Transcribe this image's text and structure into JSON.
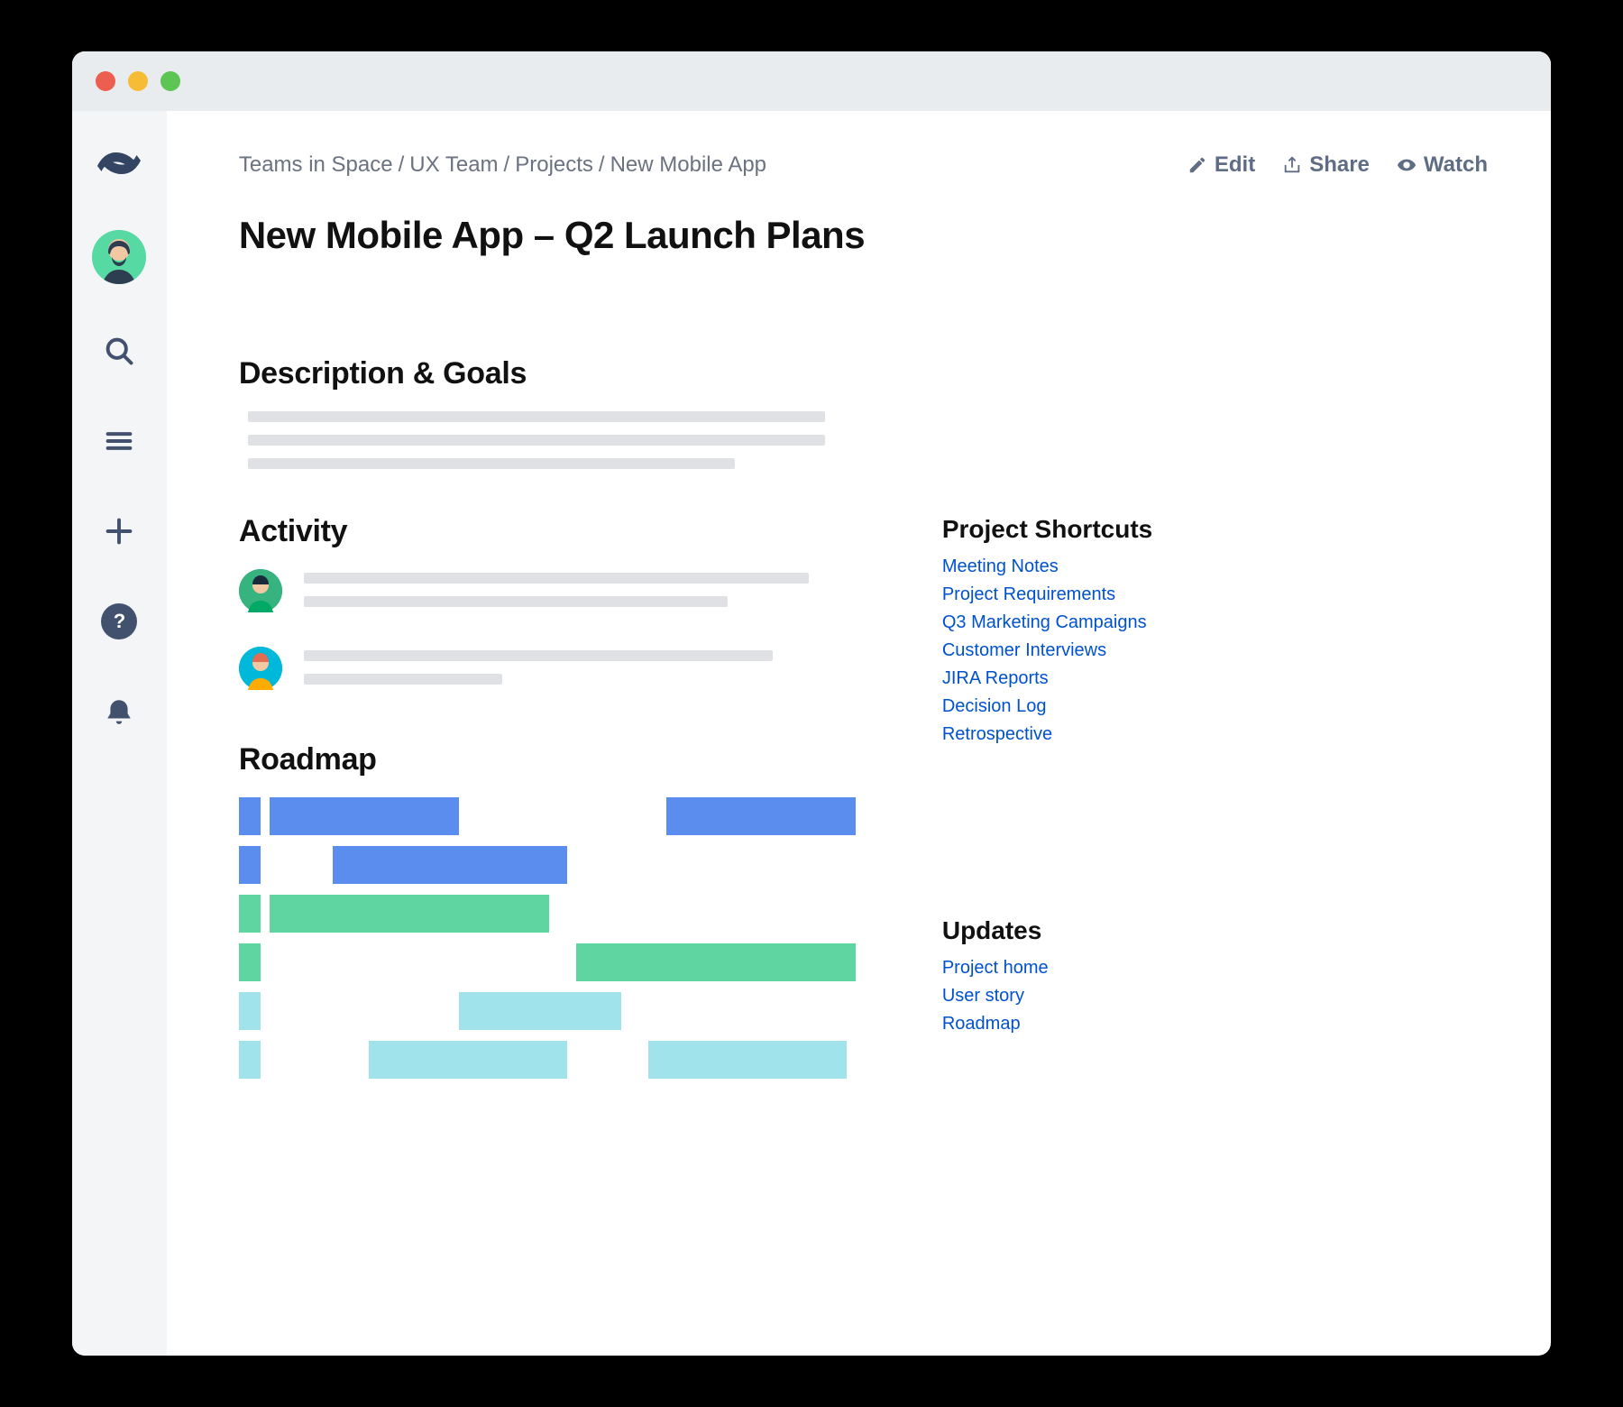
{
  "breadcrumb": [
    "Teams in Space",
    "UX Team",
    "Projects",
    "New Mobile App"
  ],
  "actions": {
    "edit": "Edit",
    "share": "Share",
    "watch": "Watch"
  },
  "page_title": "New Mobile App – Q2 Launch Plans",
  "sections": {
    "description": "Description & Goals",
    "activity": "Activity",
    "roadmap": "Roadmap"
  },
  "sidebar_right": {
    "shortcuts_heading": "Project Shortcuts",
    "shortcuts": [
      "Meeting Notes",
      "Project Requirements",
      "Q3 Marketing Campaigns",
      "Customer Interviews",
      "JIRA Reports",
      "Decision Log",
      "Retrospective"
    ],
    "updates_heading": "Updates",
    "updates": [
      "Project home",
      "User story",
      "Roadmap"
    ]
  },
  "roadmap_colors": {
    "blue": "#5b8def",
    "green": "#5fd6a2",
    "cyan": "#a1e3eb"
  }
}
